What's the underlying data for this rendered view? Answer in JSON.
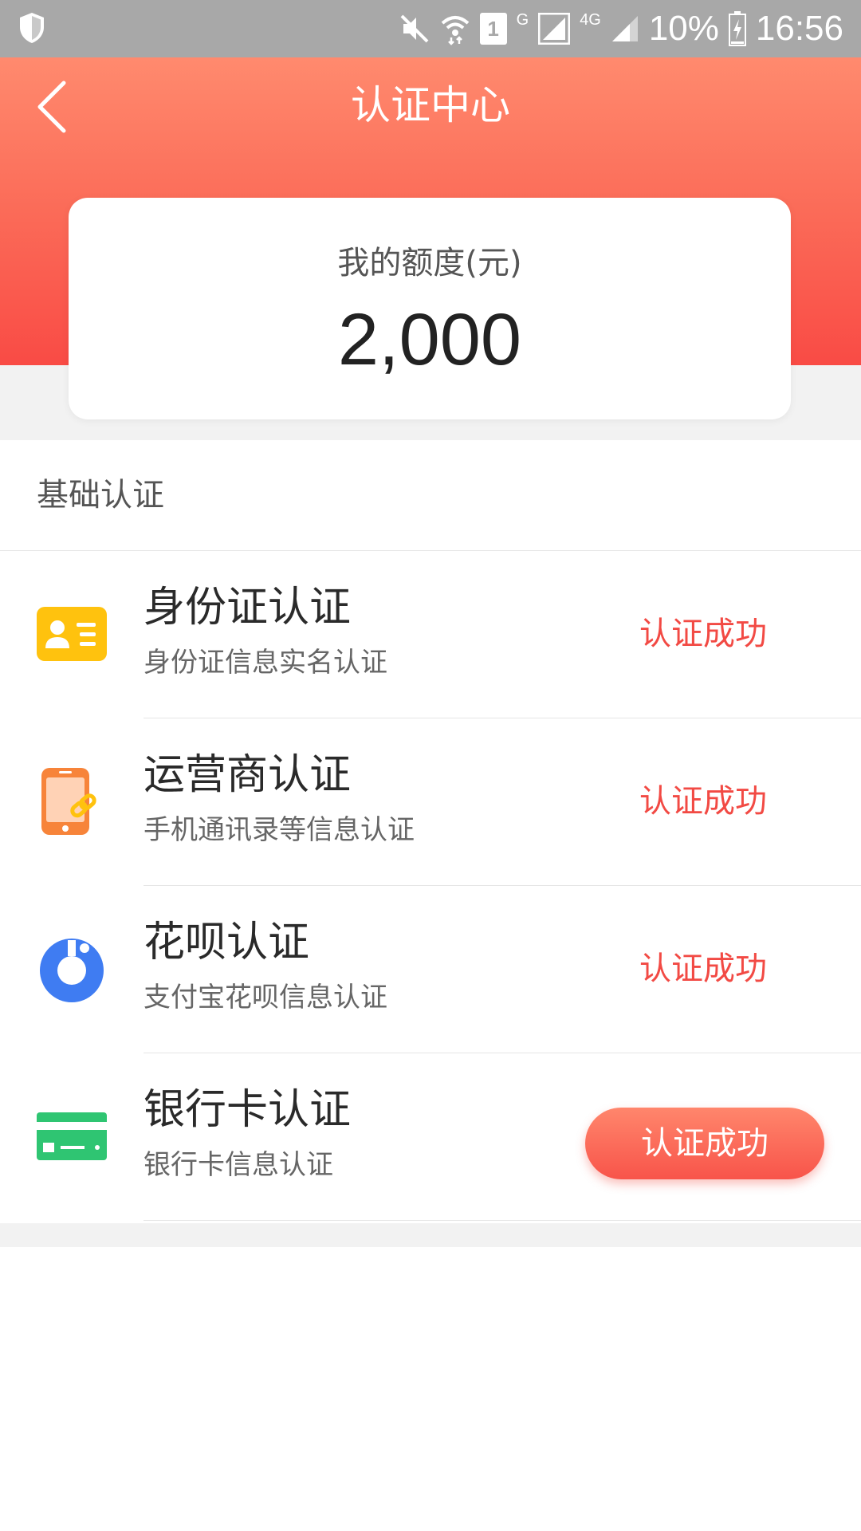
{
  "status_bar": {
    "battery": "10%",
    "time": "16:56",
    "network_badge_sim": "1",
    "network_g": "G",
    "network_4g": "4G",
    "icons": [
      "shield-icon",
      "mute-icon",
      "wifi-icon",
      "sim-icon",
      "signal-icon",
      "battery-icon"
    ]
  },
  "header": {
    "title": "认证中心"
  },
  "quota": {
    "label": "我的额度(元)",
    "value": "2,000"
  },
  "section": {
    "title": "基础认证",
    "items": [
      {
        "name": "身份证认证",
        "desc": "身份证信息实名认证",
        "status": "认证成功",
        "icon": "id-card-icon",
        "color": "#ffc20e"
      },
      {
        "name": "运营商认证",
        "desc": "手机通讯录等信息认证",
        "status": "认证成功",
        "icon": "phone-icon",
        "color": "#f7843a"
      },
      {
        "name": "花呗认证",
        "desc": "支付宝花呗信息认证",
        "status": "认证成功",
        "icon": "huabei-icon",
        "color": "#3f7cf2"
      },
      {
        "name": "银行卡认证",
        "desc": "银行卡信息认证",
        "status": "认证成功",
        "icon": "bank-card-icon",
        "color": "#2fc572"
      }
    ]
  },
  "colors": {
    "accent": "#f24a44",
    "header_gradient_top": "#ff8a6e",
    "header_gradient_bottom": "#f94b45"
  }
}
